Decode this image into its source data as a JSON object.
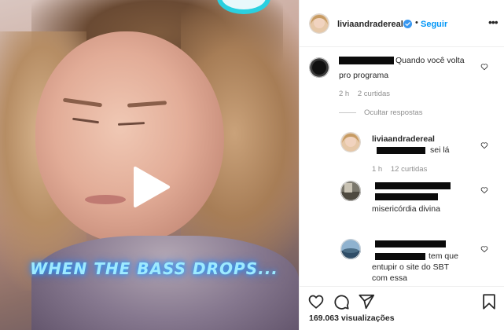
{
  "media": {
    "overlay_caption": "WHEN THE BASS DROPS...",
    "play_icon": "play-icon"
  },
  "header": {
    "username": "liviaandradereal",
    "dot": "•",
    "follow_label": "Seguir",
    "more_icon": "more-icon",
    "more_glyph": "•••"
  },
  "comments": [
    {
      "text_line1": "Quando você volta",
      "text_line2": "pro programa",
      "time": "2 h",
      "likes": "2 curtidas"
    }
  ],
  "hide_replies_label": "Ocultar respostas",
  "replies": [
    {
      "username": "liviaandradereal",
      "text": "sei lá",
      "time": "1 h",
      "likes": "12 curtidas"
    },
    {
      "text": "misericórdia divina"
    },
    {
      "text_line1": "tem que",
      "text_line2": "entupir o site do SBT",
      "text_line3": "com essa"
    }
  ],
  "actions": {
    "like_icon": "heart-icon",
    "comment_icon": "comment-icon",
    "share_icon": "send-icon",
    "save_icon": "bookmark-icon",
    "views": "169.063 visualizações"
  },
  "colors": {
    "accent_blue": "#0095f6",
    "text": "#262626",
    "muted": "#8e8e8e",
    "caption_glow": "#2aa9ff"
  }
}
